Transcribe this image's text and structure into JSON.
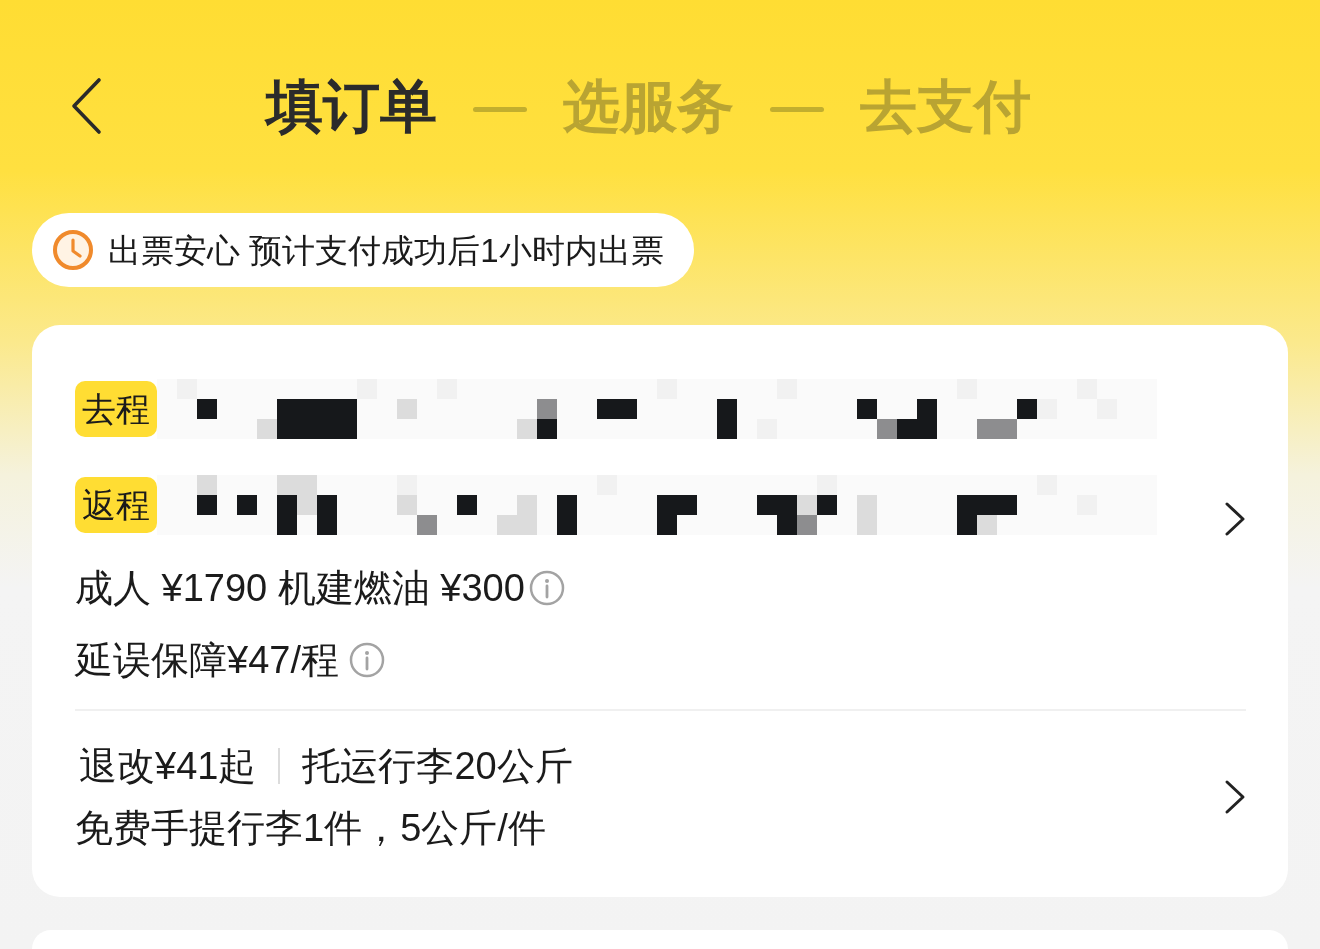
{
  "steps": [
    {
      "label": "填订单",
      "selected": true
    },
    {
      "label": "选服务",
      "selected": false
    },
    {
      "label": "去支付",
      "selected": false
    }
  ],
  "notice": {
    "text": "出票安心 预计支付成功后1小时内出票"
  },
  "itinerary": {
    "legs": [
      {
        "tag": "去程"
      },
      {
        "tag": "返程"
      }
    ],
    "fares": [
      "成人 ¥1790 机建燃油 ¥300",
      "延误保障¥47/程"
    ]
  },
  "policy": {
    "items": [
      "退改¥41起",
      "托运行李20公斤"
    ],
    "baggage": "免费手提行李1件，5公斤/件"
  }
}
